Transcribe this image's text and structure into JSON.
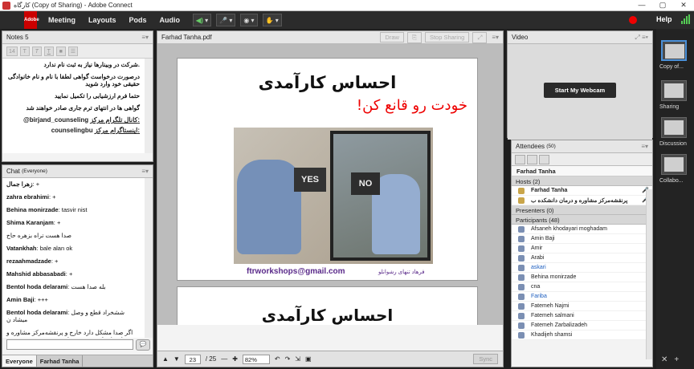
{
  "window": {
    "title": "کارگاه (Copy of Sharing) - Adobe Connect",
    "controls": [
      "—",
      "▢",
      "✕"
    ]
  },
  "menubar": {
    "logo": "Adobe",
    "items": [
      "Meeting",
      "Layouts",
      "Pods",
      "Audio"
    ],
    "help": "Help"
  },
  "notes": {
    "title": "Notes 5",
    "font_size": "14",
    "lines": [
      ".شرکت در وبینارها نیاز به ثبت نام ندارد",
      "درصورت درخواست گواهی لطفا با نام و نام خانوادگی حقیقی خود وارد شوید",
      "حتما فرم ارزشیابی را تکمیل نمایید",
      "گواهی ها در انتهای ترم جاری صادر خواهند شد"
    ],
    "channel_label": "کانال تلگرام مرکز:",
    "channel_value": "@birjand_counseling",
    "instagram_label": "اینستاگرام مرکز:",
    "instagram_value": "counselingbu"
  },
  "chat": {
    "title": "Chat",
    "scope": "(Everyone)",
    "messages": [
      {
        "name": "زهرا جمال",
        "text": "+"
      },
      {
        "name": "zahra ebrahimi",
        "text": "+"
      },
      {
        "name": "Behina monirzade",
        "text": "tasvir nist"
      },
      {
        "name": "Shima Karanjam",
        "text": "+"
      },
      {
        "name": "",
        "text": "صدا هست تراه بزهره حاج"
      },
      {
        "name": "Vatankhah",
        "text": "bale alan ok"
      },
      {
        "name": "rezaahmadzade",
        "text": "+"
      },
      {
        "name": "Mahshid abbasabadi",
        "text": "+"
      },
      {
        "name": "Bentol hoda delarami",
        "text": "بله صدا هست"
      },
      {
        "name": "Amin Baji",
        "text": "+++"
      },
      {
        "name": "Bentol hoda delarami",
        "text": "ششخراد قطع و وصل میشاد ن"
      },
      {
        "name": "",
        "text": "اگر صدا مشکل دارد خارج و پرنقشه‌مرکز مشاوره و درمان دانشکده ب مجددوارد شوید درست می شود"
      }
    ],
    "send_icon": "💬",
    "tabs": [
      "Everyone",
      "Farhad Tanha"
    ]
  },
  "share": {
    "title": "Farhad Tanha.pdf",
    "draw_label": "Draw",
    "stop_label": "Stop Sharing",
    "slide_title": "احساس کارآمدی",
    "slide_subtitle": "خودت رو قانع کن!",
    "sign_yes": "YES",
    "sign_no": "NO",
    "email": "ftrworkshops@gmail.com",
    "author": "فرهاد تنهای رشوانلو",
    "page_current": "23",
    "page_total": "/ 25",
    "zoom": "82%",
    "sync_label": "Sync"
  },
  "video": {
    "title": "Video",
    "webcam_label": "Start My Webcam"
  },
  "attendees": {
    "title": "Attendees",
    "count": "(50)",
    "me": "Farhad Tanha",
    "hosts_label": "Hosts (2)",
    "hosts": [
      "Farhad Tanha",
      "پرنقشه‌مرکز مشاوره و درمان دانشکده ب"
    ],
    "presenters_label": "Presenters (0)",
    "participants_label": "Participants (48)",
    "participants": [
      "Afsaneh khodayari moghadam",
      "Amin Baji",
      "Amir",
      "Arabi",
      "askari",
      "Behina monirzade",
      "cna",
      "Fariba",
      "Fatemeh Najmi",
      "Fatemeh salmani",
      "Fatemeh Zarbalizadeh",
      "Khadijeh shamsi"
    ]
  },
  "rail": {
    "layouts": [
      "Copy of...",
      "Sharing",
      "Discussion",
      "Collabo..."
    ]
  }
}
